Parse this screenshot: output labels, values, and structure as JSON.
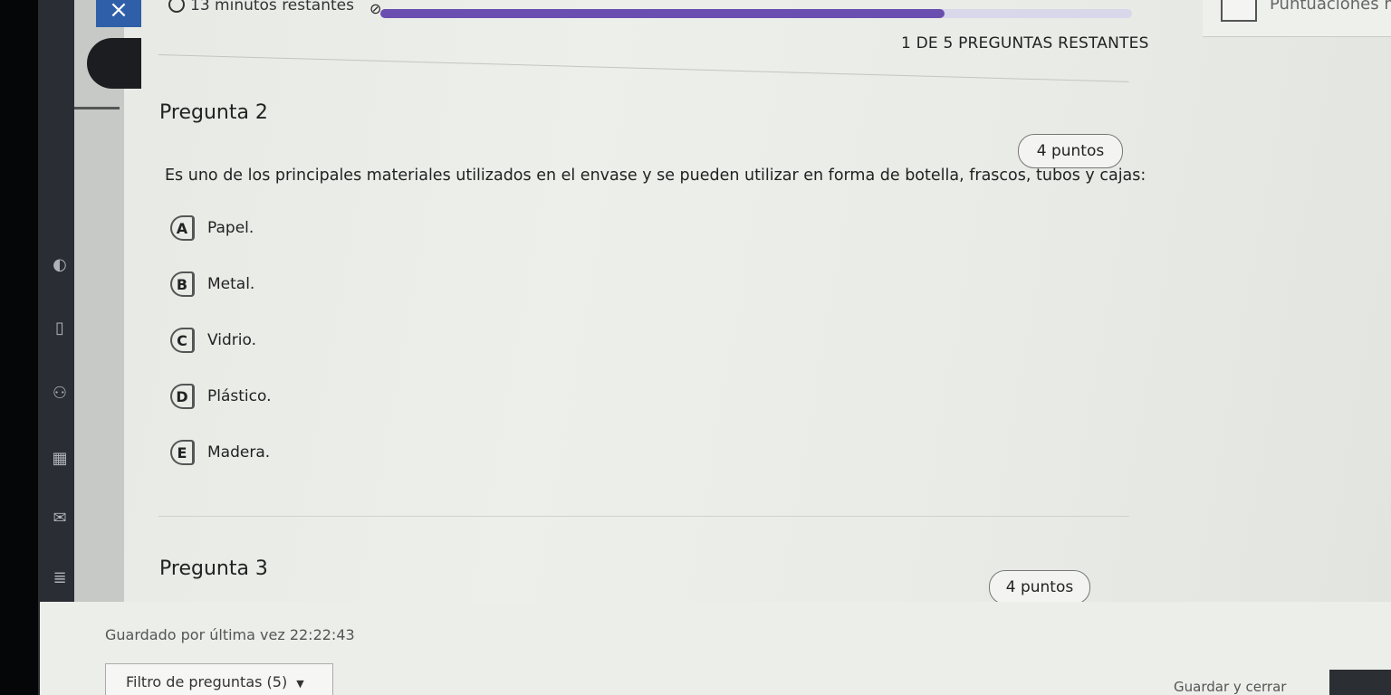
{
  "header": {
    "timer_text": "13 minutos restantes",
    "remaining_text": "1 DE 5 PREGUNTAS RESTANTES",
    "score_label": "Puntuaciones m",
    "progress_fraction": 0.75,
    "accent_color": "#6a4fb0"
  },
  "question2": {
    "title": "Pregunta 2",
    "points": "4 puntos",
    "text": "Es uno de los principales materiales utilizados en el envase y se pueden utilizar en forma de botella, frascos, tubos y cajas:",
    "options": [
      {
        "letter": "A",
        "label": "Papel."
      },
      {
        "letter": "B",
        "label": "Metal."
      },
      {
        "letter": "C",
        "label": "Vidrio."
      },
      {
        "letter": "D",
        "label": "Plástico."
      },
      {
        "letter": "E",
        "label": "Madera."
      }
    ]
  },
  "question3": {
    "title": "Pregunta 3",
    "points": "4 puntos"
  },
  "footer": {
    "saved_text": "Guardado por última vez 22:22:43",
    "filter_label": "Filtro de preguntas (5)",
    "save_close_label": "Guardar y cerrar"
  }
}
